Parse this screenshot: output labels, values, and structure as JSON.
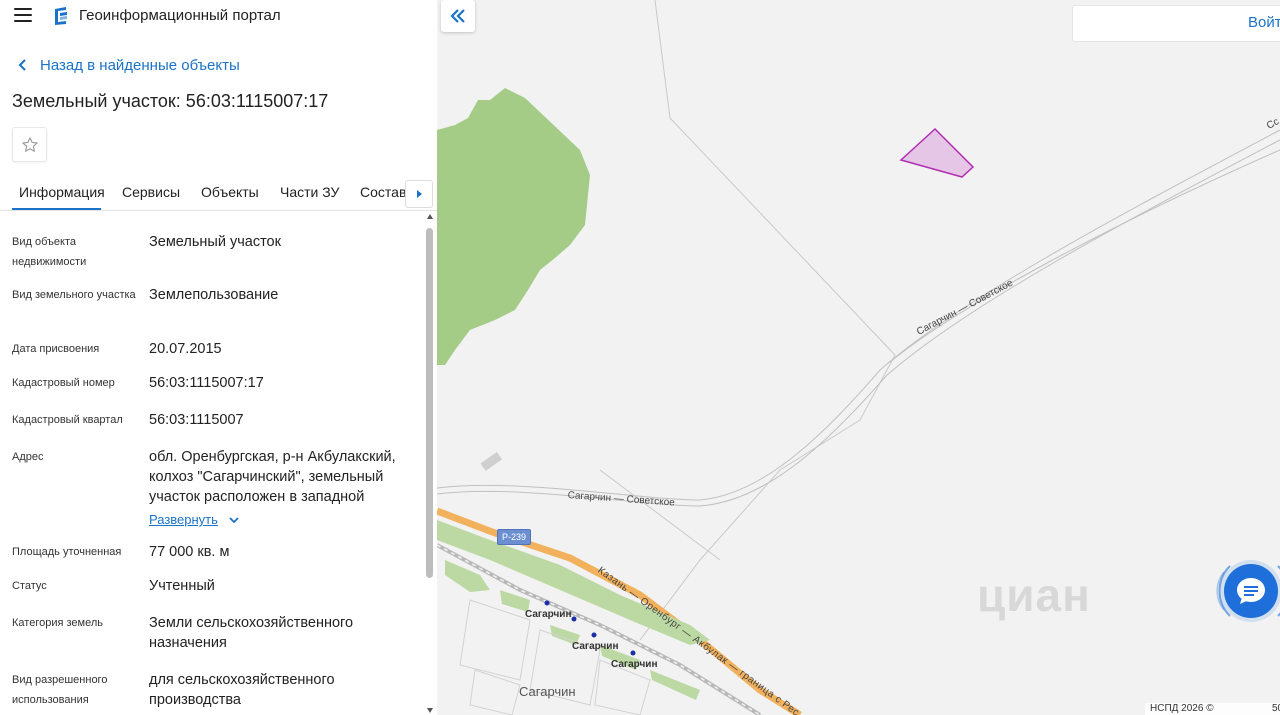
{
  "app": {
    "title": "Геоинформационный портал"
  },
  "nav": {
    "back_label": "Назад в найденные объекты"
  },
  "object": {
    "title": "Земельный участок: 56:03:1115007:17"
  },
  "tabs": [
    {
      "label": "Информация",
      "active": true
    },
    {
      "label": "Сервисы",
      "active": false
    },
    {
      "label": "Объекты",
      "active": false
    },
    {
      "label": "Части ЗУ",
      "active": false
    },
    {
      "label": "Состав",
      "active": false
    }
  ],
  "properties": [
    {
      "label": "Вид объекта недвижимости",
      "value": "Земельный участок"
    },
    {
      "label": "Вид земельного участка",
      "value": "Землепользование"
    },
    {
      "label": "Дата присвоения",
      "value": "20.07.2015"
    },
    {
      "label": "Кадастровый номер",
      "value": "56:03:1115007:17"
    },
    {
      "label": "Кадастровый квартал",
      "value": "56:03:1115007"
    },
    {
      "label": "Адрес",
      "value": "обл. Оренбургская, р-н Акбулакский, колхоз \"Сагарчинский\", земельный участок расположен в западной",
      "expand_label": "Развернуть"
    },
    {
      "label": "Площадь уточненная",
      "value": "77 000 кв. м"
    },
    {
      "label": "Статус",
      "value": "Учтенный"
    },
    {
      "label": "Категория земель",
      "value": "Земли сельскохозяйственного назначения"
    },
    {
      "label": "Вид разрешенного использования",
      "value": "для сельскохозяйственного производства"
    }
  ],
  "header_right": {
    "login_label": "Войт"
  },
  "map": {
    "road_label_1": "Сагарчин — Советское",
    "road_label_2": "Сагарчин — Советское",
    "highway_badge": "Р-239",
    "highway_label": "Казань — Оренбург — Акбулак — граница с Рес",
    "station_1": "Сагарчин",
    "station_2": "Сагарчин",
    "station_3": "Сагарчин",
    "town": "Сагарчин",
    "corner_label": "Сс",
    "watermark": "циан",
    "attribution": "НСПД 2026 ©",
    "scale": "50",
    "colors": {
      "forest": "#a5cc87",
      "parcel_fill": "#e6c6e6",
      "parcel_stroke": "#b12eb1",
      "highway": "#f2b15c",
      "accent": "#1a73c8",
      "chat": "#1e6fd9"
    }
  }
}
